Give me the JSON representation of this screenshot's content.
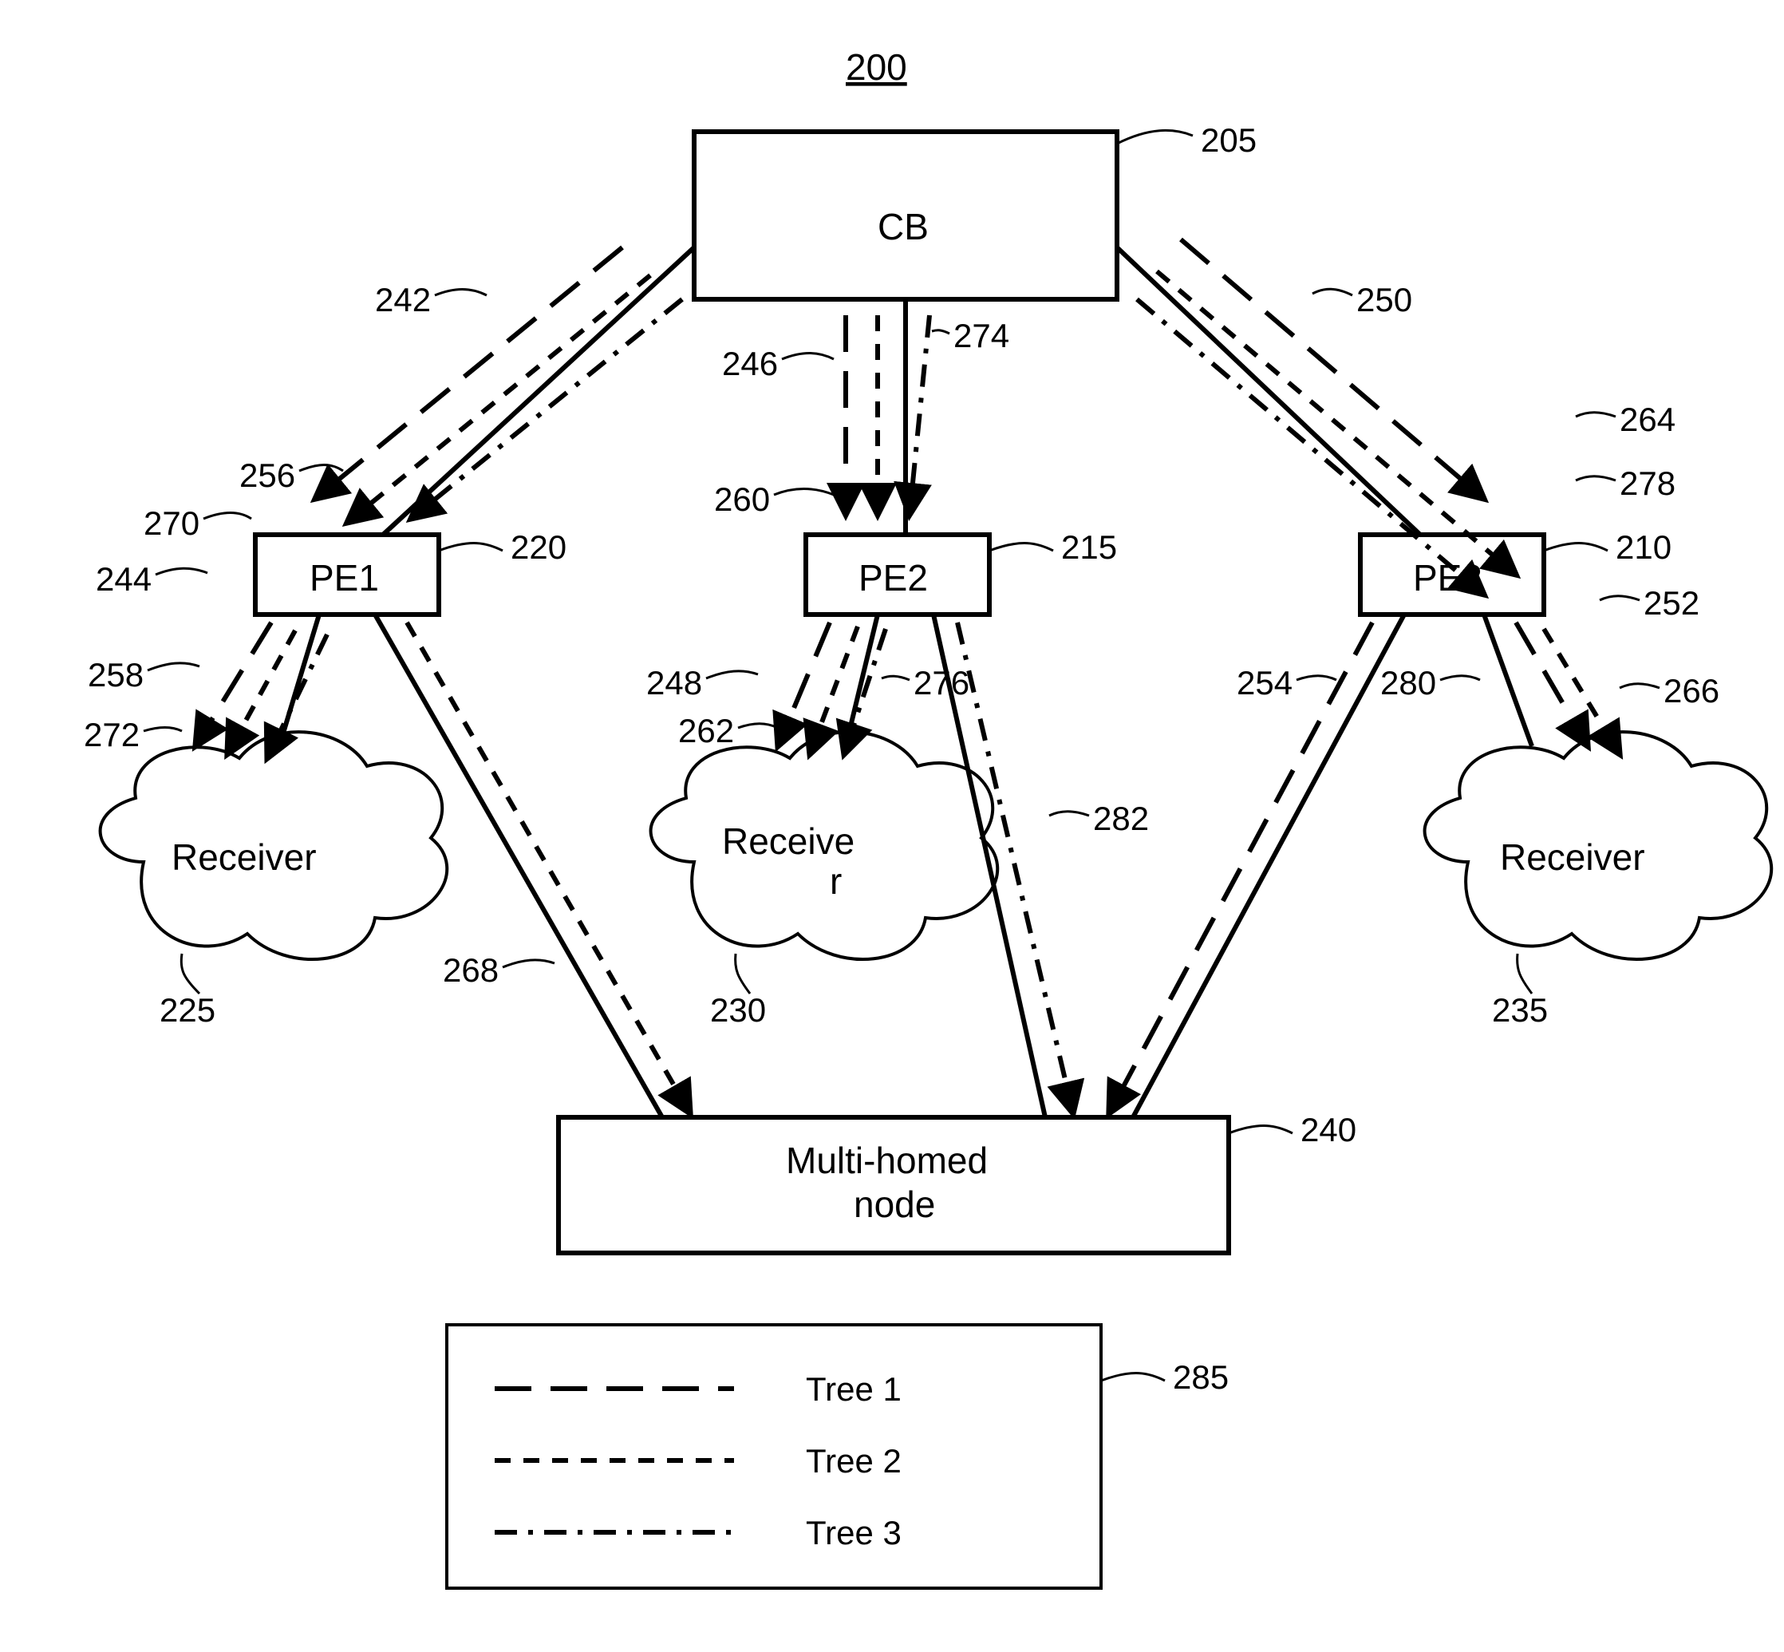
{
  "figure_id": "200",
  "nodes": {
    "cb": {
      "label": "CB",
      "ref": "205"
    },
    "pe1": {
      "label": "PE1",
      "ref": "220"
    },
    "pe2": {
      "label": "PE2",
      "ref": "215"
    },
    "pe3": {
      "label": "PE3",
      "ref": "210"
    },
    "mhn": {
      "label_line1": "Multi-homed",
      "label_line2": "node",
      "ref": "240"
    },
    "rx1": {
      "label": "Receiver",
      "ref": "225"
    },
    "rx2": {
      "label_line1": "Receive",
      "label_line2": "r",
      "ref": "230"
    },
    "rx3": {
      "label": "Receiver",
      "ref": "235"
    }
  },
  "legend": {
    "tree1": "Tree 1",
    "tree2": "Tree 2",
    "tree3": "Tree 3",
    "ref": "285"
  },
  "refs": {
    "r242": "242",
    "r244": "244",
    "r246": "246",
    "r248": "248",
    "r250": "250",
    "r252": "252",
    "r254": "254",
    "r256": "256",
    "r258": "258",
    "r260": "260",
    "r262": "262",
    "r264": "264",
    "r266": "266",
    "r268": "268",
    "r270": "270",
    "r272": "272",
    "r274": "274",
    "r276": "276",
    "r278": "278",
    "r280": "280",
    "r282": "282"
  }
}
